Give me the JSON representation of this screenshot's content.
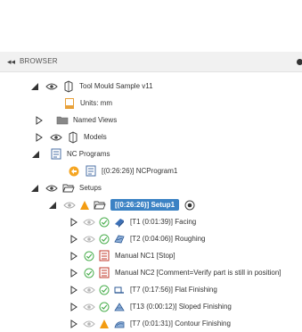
{
  "panel": {
    "title": "BROWSER",
    "collapse_glyph": "◂◂"
  },
  "tree": {
    "root": "Tool Mould Sample v11",
    "units": "Units: mm",
    "named_views": "Named Views",
    "models": "Models",
    "nc_programs": "NC Programs",
    "nc_program1": "[(0:26:26)] NCProgram1",
    "setups": "Setups",
    "setup1": "[(0:26:26)] Setup1",
    "ops": [
      {
        "label": "[T1 (0:01:39)] Facing",
        "status": "ok",
        "icon": "facing-icon"
      },
      {
        "label": "[T2 (0:04:06)] Roughing",
        "status": "ok",
        "icon": "roughing-icon"
      },
      {
        "label": "Manual NC1 [Stop]",
        "status": "ok",
        "icon": "manual-nc-icon"
      },
      {
        "label": "Manual NC2 [Comment=Verify part is still in position]",
        "status": "ok",
        "icon": "manual-nc-icon"
      },
      {
        "label": "[T7 (0:17:56)] Flat Finishing",
        "status": "ok",
        "icon": "flat-icon"
      },
      {
        "label": "[T13 (0:00:12)] Sloped Finishing",
        "status": "ok",
        "icon": "sloped-icon"
      },
      {
        "label": "[T7 (0:01:31)] Contour Finishing",
        "status": "warning",
        "icon": "contour-icon"
      }
    ]
  },
  "colors": {
    "selected": "#3b82c4",
    "ok_green": "#4caf50",
    "warning_orange": "#f39c12"
  }
}
